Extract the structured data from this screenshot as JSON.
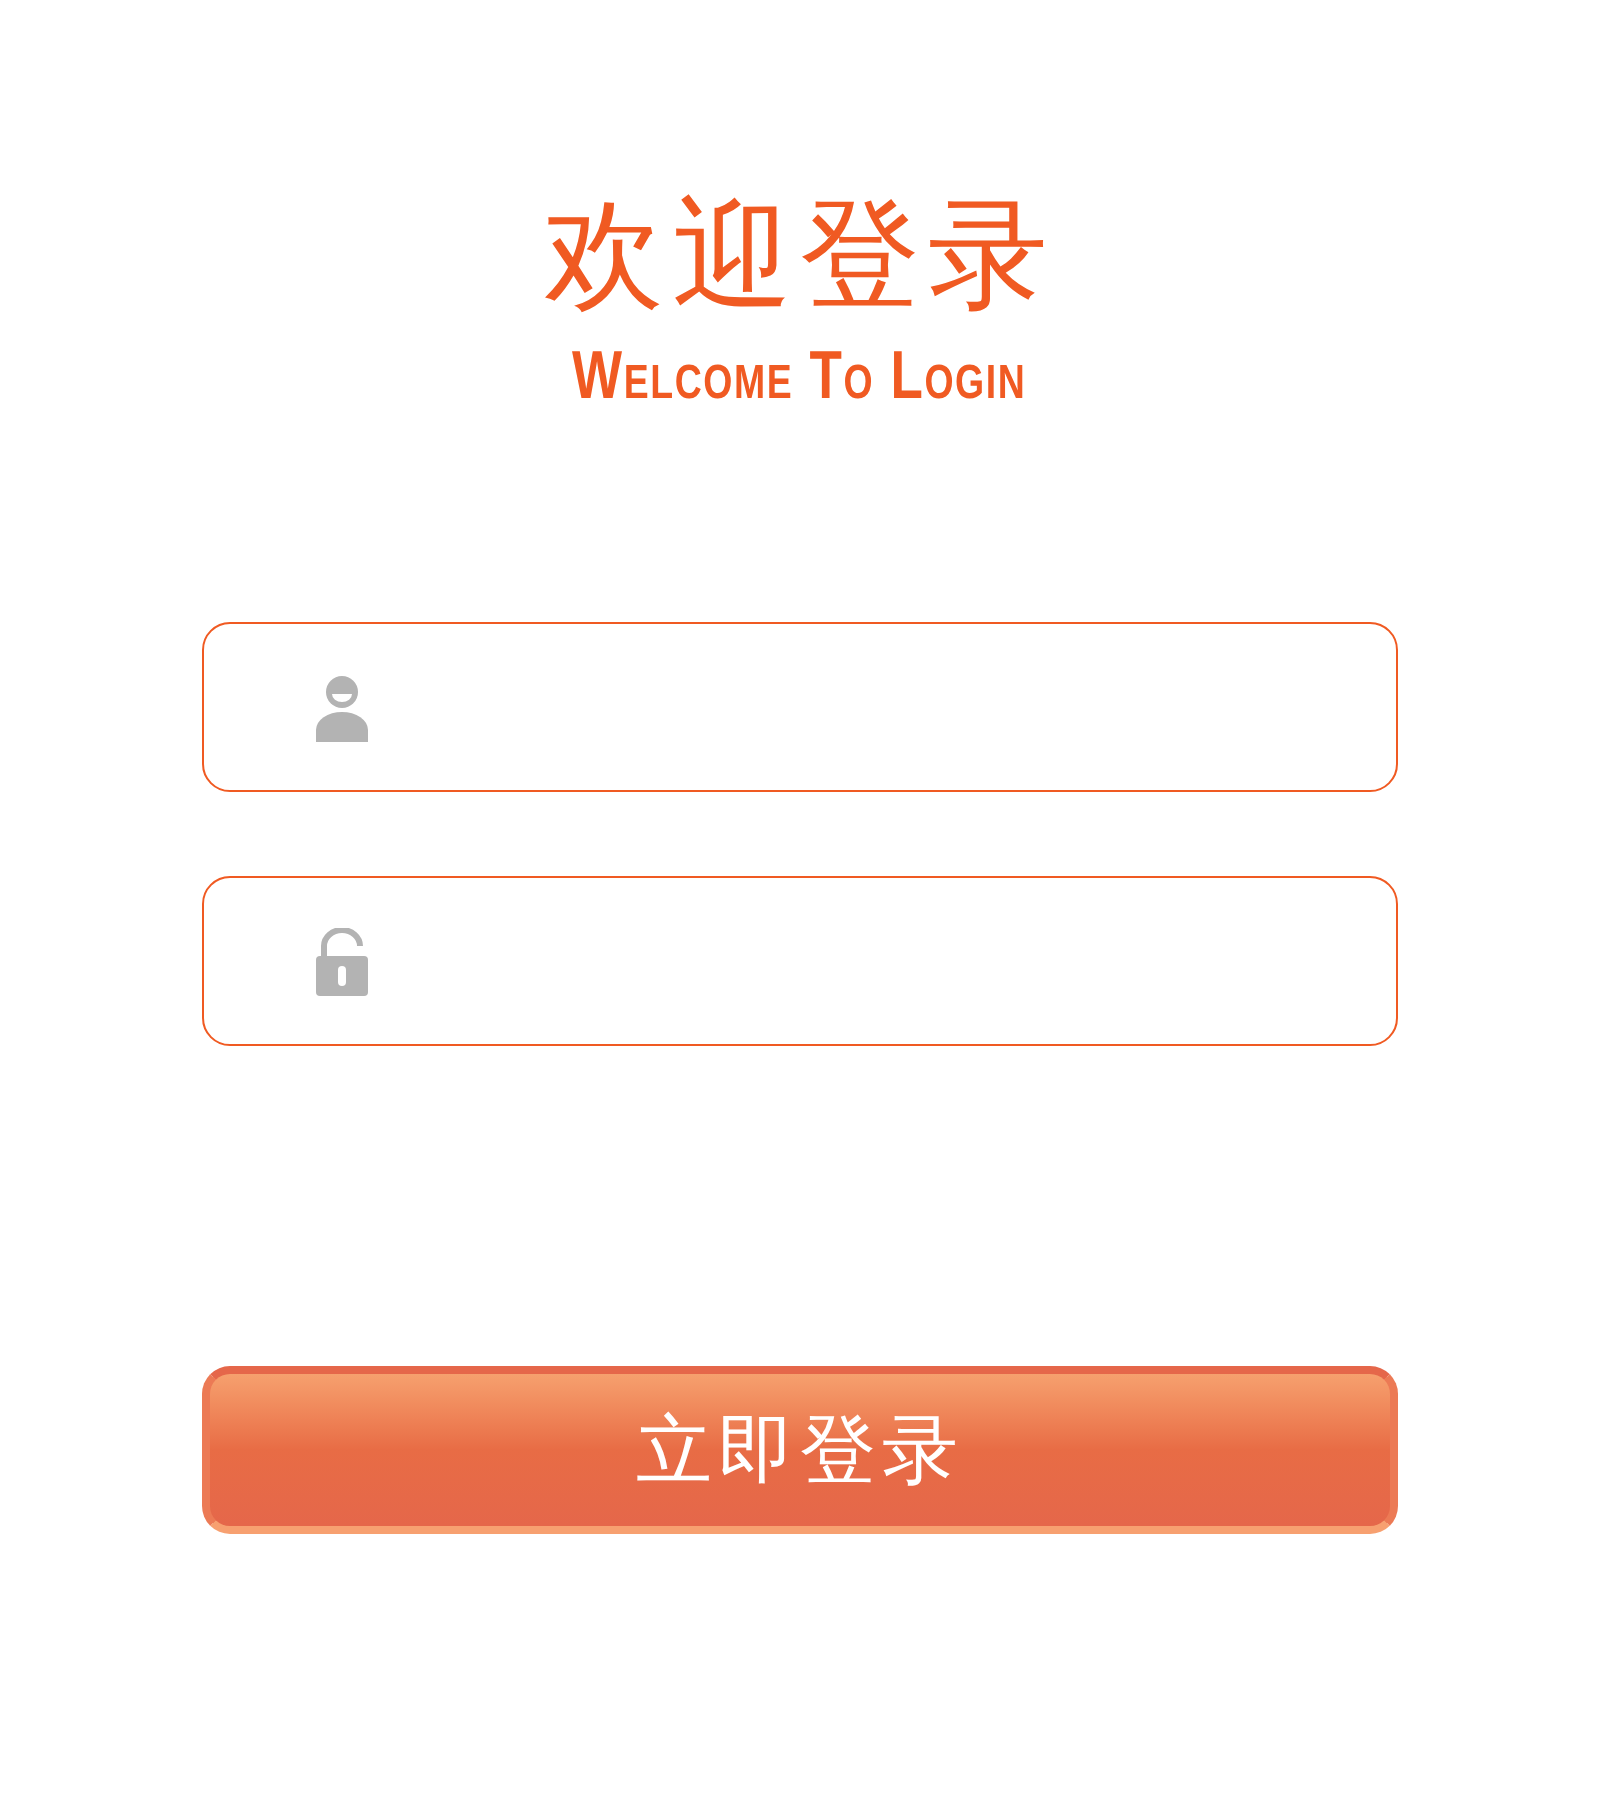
{
  "title": "欢迎登录",
  "subtitle": "Welcome To Login",
  "fields": [
    {
      "kind": "user"
    },
    {
      "kind": "password"
    }
  ],
  "login_button": "立即登录"
}
